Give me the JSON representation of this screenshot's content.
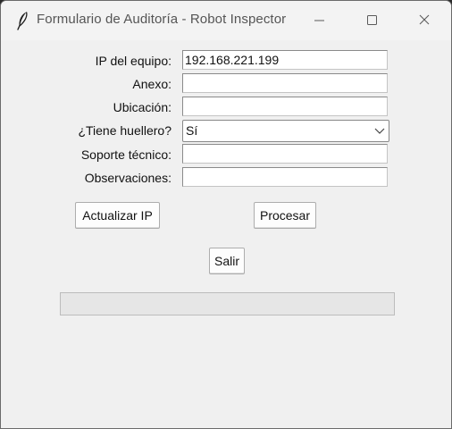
{
  "window": {
    "title": "Formulario de Auditoría - Robot Inspector",
    "app_icon": "feather-icon",
    "controls": [
      "minimize-icon",
      "maximize-icon",
      "close-icon"
    ]
  },
  "form": {
    "ip": {
      "label": "IP del equipo:",
      "value": "192.168.221.199"
    },
    "anexo": {
      "label": "Anexo:",
      "value": ""
    },
    "ubicacion": {
      "label": "Ubicación:",
      "value": ""
    },
    "huellero": {
      "label": "¿Tiene huellero?",
      "selected": "Sí"
    },
    "soporte": {
      "label": "Soporte técnico:",
      "value": ""
    },
    "observaciones": {
      "label": "Observaciones:",
      "value": ""
    }
  },
  "buttons": {
    "update_ip": "Actualizar IP",
    "process": "Procesar",
    "exit": "Salir"
  },
  "progress": {
    "fraction": 0
  },
  "colors": {
    "progress_fill": "#06b025",
    "window_bg": "#f0f0f0"
  }
}
